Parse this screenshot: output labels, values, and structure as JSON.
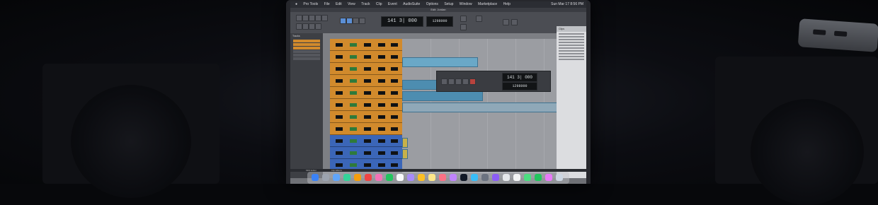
{
  "menubar": {
    "app": "Pro Tools",
    "items": [
      "File",
      "Edit",
      "View",
      "Track",
      "Clip",
      "Event",
      "AudioSuite",
      "Options",
      "Setup",
      "Window",
      "Marketplace",
      "Help"
    ],
    "clock": "Sun Mar 17  8:56 PM"
  },
  "window": {
    "title": "Edit: Jordan"
  },
  "transport": {
    "main_counter": "141 3| 000",
    "sub_counter": "1298000",
    "tool_colors": {
      "active": "#5b8fd6",
      "idle": "#5a5c63"
    }
  },
  "floating_transport": {
    "counter": "141 3| 000",
    "samples": "1298000"
  },
  "left_panel": {
    "title": "Tracks"
  },
  "right_panel": {
    "title": "Clips"
  },
  "bottom_bar": {
    "left": "MIDI Editor",
    "right": "Clip Effects"
  },
  "track_colors": {
    "orange": "#d18a2c",
    "blue": "#3b66b8"
  },
  "tracks": [
    {
      "color": "orange"
    },
    {
      "color": "orange"
    },
    {
      "color": "orange"
    },
    {
      "color": "orange"
    },
    {
      "color": "orange"
    },
    {
      "color": "orange"
    },
    {
      "color": "orange"
    },
    {
      "color": "orange"
    },
    {
      "color": "blue"
    },
    {
      "color": "blue"
    },
    {
      "color": "blue"
    }
  ],
  "dock_apps": [
    "finder",
    "launchpad",
    "safari",
    "messages",
    "mail",
    "maps",
    "photos",
    "facetime",
    "calendar",
    "contacts",
    "reminders",
    "notes",
    "music",
    "podcasts",
    "tv",
    "app-store",
    "settings",
    "pro-tools",
    "logic",
    "ableton-live",
    "chrome",
    "spotify",
    "slack",
    "trash"
  ]
}
